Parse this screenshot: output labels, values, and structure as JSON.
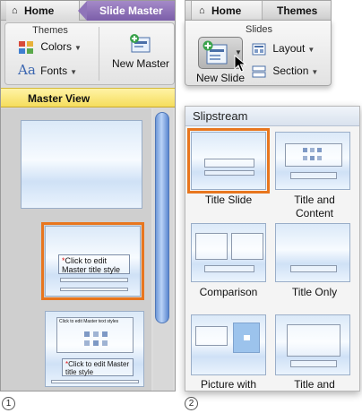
{
  "left": {
    "tabs": {
      "home": "Home",
      "slide_master": "Slide Master"
    },
    "ribbon": {
      "group_title": "Themes",
      "colors_label": "Colors",
      "fonts_label": "Fonts",
      "new_master_label": "New Master"
    },
    "master_view_label": "Master View",
    "slide2": {
      "title_placeholder": "Click to edit Master title style"
    },
    "slide3": {
      "body_placeholder": "Click to edit Master text styles",
      "title_placeholder": "Click to edit Master title style"
    },
    "callout": "1"
  },
  "right": {
    "tabs": {
      "home": "Home",
      "themes": "Themes"
    },
    "ribbon": {
      "group_title": "Slides",
      "new_slide_label": "New Slide",
      "layout_label": "Layout",
      "section_label": "Section"
    },
    "gallery": {
      "title": "Slipstream",
      "layouts": [
        {
          "line1": "Title Slide",
          "line2": ""
        },
        {
          "line1": "Title and",
          "line2": "Content"
        },
        {
          "line1": "Comparison",
          "line2": ""
        },
        {
          "line1": "Title Only",
          "line2": ""
        },
        {
          "line1": "Picture with",
          "line2": ""
        },
        {
          "line1": "Title and",
          "line2": ""
        }
      ]
    },
    "callout": "2"
  },
  "colors": {
    "accent_orange": "#e8761e",
    "master_tab_purple": "#8f74b9",
    "master_view_yellow": "#f5dd5c"
  },
  "icons": [
    "home-icon",
    "colors-icon",
    "fonts-icon",
    "new-master-icon",
    "new-slide-icon",
    "layout-icon",
    "section-icon",
    "mouse-cursor-icon"
  ]
}
